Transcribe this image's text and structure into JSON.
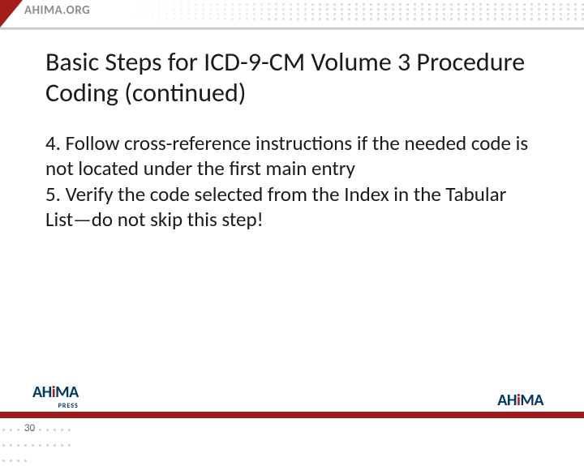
{
  "header": {
    "site": "AHIMA.ORG"
  },
  "slide": {
    "title": "Basic Steps for ICD-9-CM Volume 3 Procedure Coding (continued)",
    "point4": "4. Follow cross-reference instructions if the needed code is not located under the first main entry",
    "point5": "5. Verify the code selected from the Index in the Tabular List—do not skip this step!"
  },
  "footer": {
    "logo_left_main": "AH",
    "logo_left_accent": "i",
    "logo_left_rest": "MA",
    "logo_left_sub": "PRESS",
    "logo_right_main": "AH",
    "logo_right_accent": "i",
    "logo_right_rest": "MA",
    "page": "30"
  }
}
